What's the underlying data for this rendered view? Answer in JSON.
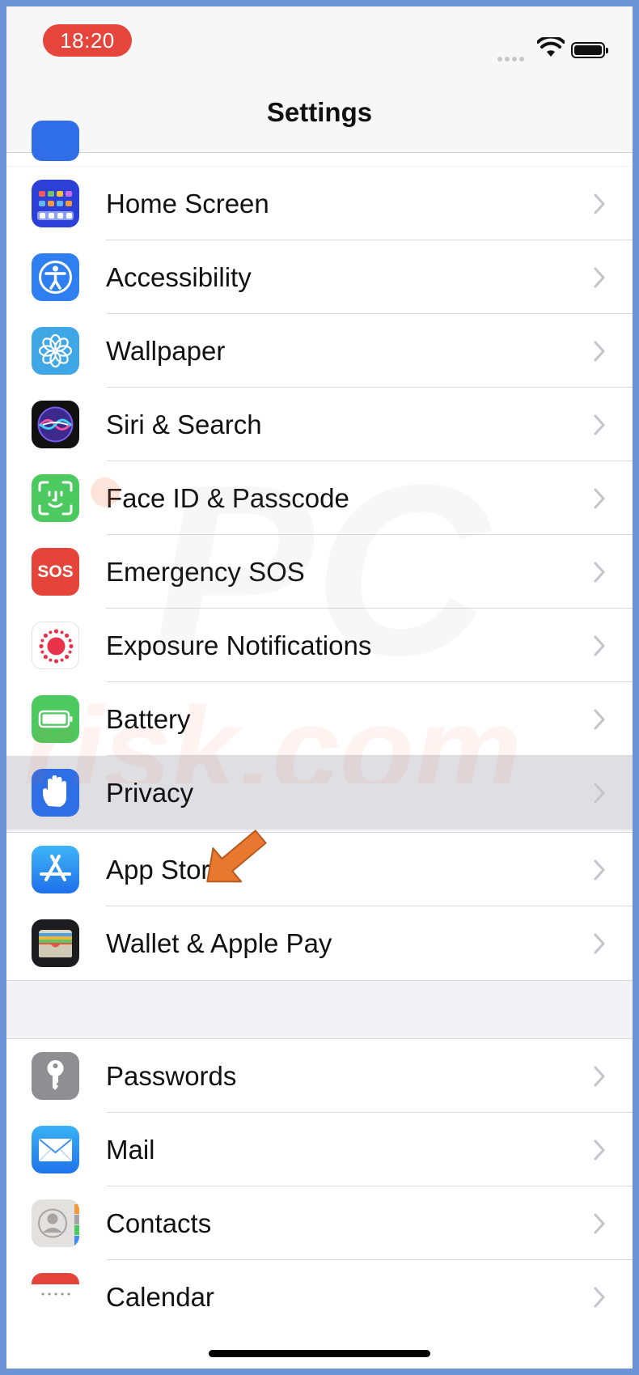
{
  "status_bar": {
    "time": "18:20"
  },
  "nav": {
    "title": "Settings"
  },
  "groups": [
    {
      "items": [
        {
          "label": "Home Screen",
          "icon": "home-screen-icon"
        },
        {
          "label": "Accessibility",
          "icon": "accessibility-icon"
        },
        {
          "label": "Wallpaper",
          "icon": "wallpaper-icon"
        },
        {
          "label": "Siri & Search",
          "icon": "siri-icon"
        },
        {
          "label": "Face ID & Passcode",
          "icon": "face-id-icon"
        },
        {
          "label": "Emergency SOS",
          "icon": "sos-icon",
          "icon_text": "SOS"
        },
        {
          "label": "Exposure Notifications",
          "icon": "exposure-notifications-icon"
        },
        {
          "label": "Battery",
          "icon": "battery-setting-icon"
        },
        {
          "label": "Privacy",
          "icon": "privacy-hand-icon",
          "highlighted": true
        }
      ]
    },
    {
      "items": [
        {
          "label": "App Store",
          "icon": "app-store-icon"
        },
        {
          "label": "Wallet & Apple Pay",
          "icon": "wallet-icon"
        }
      ]
    },
    {
      "items": [
        {
          "label": "Passwords",
          "icon": "key-icon"
        },
        {
          "label": "Mail",
          "icon": "mail-icon"
        },
        {
          "label": "Contacts",
          "icon": "contacts-icon"
        },
        {
          "label": "Calendar",
          "icon": "calendar-icon"
        }
      ]
    }
  ],
  "watermark": {
    "text_top": "PC",
    "text_bottom": "risk.com"
  },
  "colors": {
    "time_pill": "#e5453a",
    "highlight_row": "#dedee3",
    "pointer_arrow": "#e8782f",
    "background": "#f2f2f7"
  }
}
